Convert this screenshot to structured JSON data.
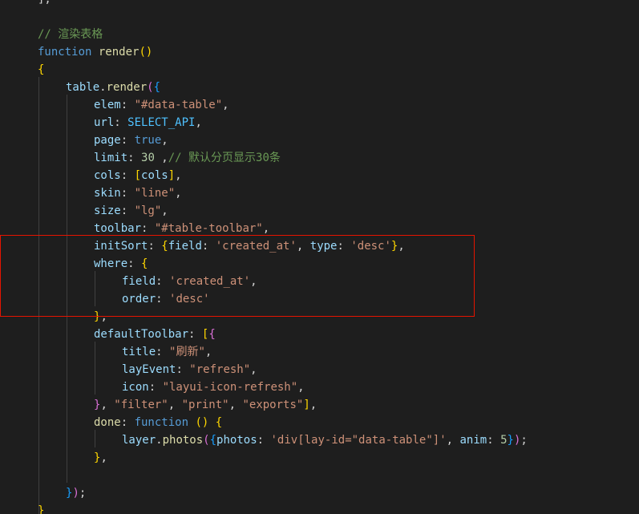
{
  "editor": {
    "theme": "dark",
    "colors": {
      "background": "#1e1e1e",
      "keyword": "#569cd6",
      "function": "#dcdcaa",
      "property": "#9cdcfe",
      "constant": "#4fc1ff",
      "string": "#ce9178",
      "number": "#b5cea8",
      "comment": "#6a9955",
      "highlight_border": "#e51400"
    },
    "lines": [
      {
        "indent": 1,
        "tokens": [
          [
            "pun",
            "],"
          ]
        ]
      },
      {
        "indent": 0,
        "tokens": []
      },
      {
        "indent": 1,
        "tokens": [
          [
            "cmt",
            "// "
          ],
          [
            "cmt cjk",
            "渲染表格"
          ]
        ]
      },
      {
        "indent": 1,
        "tokens": [
          [
            "kw",
            "function"
          ],
          [
            "pun",
            " "
          ],
          [
            "fn",
            "render"
          ],
          [
            "br1",
            "()"
          ]
        ]
      },
      {
        "indent": 1,
        "tokens": [
          [
            "br1",
            "{"
          ]
        ]
      },
      {
        "indent": 2,
        "tokens": [
          [
            "var",
            "table"
          ],
          [
            "pun",
            "."
          ],
          [
            "fn",
            "render"
          ],
          [
            "br2",
            "("
          ],
          [
            "br3",
            "{"
          ]
        ]
      },
      {
        "indent": 3,
        "tokens": [
          [
            "var",
            "elem"
          ],
          [
            "pun",
            ": "
          ],
          [
            "str",
            "\"#data-table\""
          ],
          [
            "pun",
            ","
          ]
        ]
      },
      {
        "indent": 3,
        "tokens": [
          [
            "var",
            "url"
          ],
          [
            "pun",
            ": "
          ],
          [
            "const",
            "SELECT_API"
          ],
          [
            "pun",
            ","
          ]
        ]
      },
      {
        "indent": 3,
        "tokens": [
          [
            "var",
            "page"
          ],
          [
            "pun",
            ": "
          ],
          [
            "kw",
            "true"
          ],
          [
            "pun",
            ","
          ]
        ]
      },
      {
        "indent": 3,
        "tokens": [
          [
            "var",
            "limit"
          ],
          [
            "pun",
            ": "
          ],
          [
            "num",
            "30"
          ],
          [
            "pun",
            " ,"
          ],
          [
            "cmt",
            "// "
          ],
          [
            "cmt cjk",
            "默认分页显示"
          ],
          [
            "cmt",
            "30"
          ],
          [
            "cmt cjk",
            "条"
          ]
        ]
      },
      {
        "indent": 3,
        "tokens": [
          [
            "var",
            "cols"
          ],
          [
            "pun",
            ": "
          ],
          [
            "br1",
            "["
          ],
          [
            "var",
            "cols"
          ],
          [
            "br1",
            "]"
          ],
          [
            "pun",
            ","
          ]
        ]
      },
      {
        "indent": 3,
        "tokens": [
          [
            "var",
            "skin"
          ],
          [
            "pun",
            ": "
          ],
          [
            "str",
            "\"line\""
          ],
          [
            "pun",
            ","
          ]
        ]
      },
      {
        "indent": 3,
        "tokens": [
          [
            "var",
            "size"
          ],
          [
            "pun",
            ": "
          ],
          [
            "str",
            "\"lg\""
          ],
          [
            "pun",
            ","
          ]
        ]
      },
      {
        "indent": 3,
        "tokens": [
          [
            "var",
            "toolbar"
          ],
          [
            "pun",
            ": "
          ],
          [
            "str",
            "\"#table-toolbar\""
          ],
          [
            "pun",
            ","
          ]
        ]
      },
      {
        "indent": 3,
        "tokens": [
          [
            "var",
            "initSort"
          ],
          [
            "pun",
            ": "
          ],
          [
            "br1",
            "{"
          ],
          [
            "var",
            "field"
          ],
          [
            "pun",
            ": "
          ],
          [
            "str",
            "'created_at'"
          ],
          [
            "pun",
            ", "
          ],
          [
            "var",
            "type"
          ],
          [
            "pun",
            ": "
          ],
          [
            "str",
            "'desc'"
          ],
          [
            "br1",
            "}"
          ],
          [
            "pun",
            ","
          ]
        ]
      },
      {
        "indent": 3,
        "tokens": [
          [
            "var",
            "where"
          ],
          [
            "pun",
            ": "
          ],
          [
            "br1",
            "{"
          ]
        ]
      },
      {
        "indent": 4,
        "tokens": [
          [
            "var",
            "field"
          ],
          [
            "pun",
            ": "
          ],
          [
            "str",
            "'created_at'"
          ],
          [
            "pun",
            ","
          ]
        ]
      },
      {
        "indent": 4,
        "tokens": [
          [
            "var",
            "order"
          ],
          [
            "pun",
            ": "
          ],
          [
            "str",
            "'desc'"
          ]
        ]
      },
      {
        "indent": 3,
        "tokens": [
          [
            "br1",
            "}"
          ],
          [
            "pun",
            ","
          ]
        ]
      },
      {
        "indent": 3,
        "tokens": [
          [
            "var",
            "defaultToolbar"
          ],
          [
            "pun",
            ": "
          ],
          [
            "br1",
            "["
          ],
          [
            "br2",
            "{"
          ]
        ]
      },
      {
        "indent": 4,
        "tokens": [
          [
            "var",
            "title"
          ],
          [
            "pun",
            ": "
          ],
          [
            "str",
            "\""
          ],
          [
            "str cjk",
            "刷新"
          ],
          [
            "str",
            "\""
          ],
          [
            "pun",
            ","
          ]
        ]
      },
      {
        "indent": 4,
        "tokens": [
          [
            "var",
            "layEvent"
          ],
          [
            "pun",
            ": "
          ],
          [
            "str",
            "\"refresh\""
          ],
          [
            "pun",
            ","
          ]
        ]
      },
      {
        "indent": 4,
        "tokens": [
          [
            "var",
            "icon"
          ],
          [
            "pun",
            ": "
          ],
          [
            "str",
            "\"layui-icon-refresh\""
          ],
          [
            "pun",
            ","
          ]
        ]
      },
      {
        "indent": 3,
        "tokens": [
          [
            "br2",
            "}"
          ],
          [
            "pun",
            ", "
          ],
          [
            "str",
            "\"filter\""
          ],
          [
            "pun",
            ", "
          ],
          [
            "str",
            "\"print\""
          ],
          [
            "pun",
            ", "
          ],
          [
            "str",
            "\"exports\""
          ],
          [
            "br1",
            "]"
          ],
          [
            "pun",
            ","
          ]
        ]
      },
      {
        "indent": 3,
        "tokens": [
          [
            "fn",
            "done"
          ],
          [
            "pun",
            ": "
          ],
          [
            "kw",
            "function"
          ],
          [
            "pun",
            " "
          ],
          [
            "br1",
            "()"
          ],
          [
            "pun",
            " "
          ],
          [
            "br1",
            "{"
          ]
        ]
      },
      {
        "indent": 4,
        "tokens": [
          [
            "var",
            "layer"
          ],
          [
            "pun",
            "."
          ],
          [
            "fn",
            "photos"
          ],
          [
            "br2",
            "("
          ],
          [
            "br3",
            "{"
          ],
          [
            "var",
            "photos"
          ],
          [
            "pun",
            ": "
          ],
          [
            "str",
            "'div[lay-id=\"data-table\"]'"
          ],
          [
            "pun",
            ", "
          ],
          [
            "var",
            "anim"
          ],
          [
            "pun",
            ": "
          ],
          [
            "num",
            "5"
          ],
          [
            "br3",
            "}"
          ],
          [
            "br2",
            ")"
          ],
          [
            "pun",
            ";"
          ]
        ]
      },
      {
        "indent": 3,
        "tokens": [
          [
            "br1",
            "}"
          ],
          [
            "pun",
            ","
          ]
        ]
      },
      {
        "indent": 0,
        "tokens": []
      },
      {
        "indent": 2,
        "tokens": [
          [
            "br3",
            "}"
          ],
          [
            "br2",
            ")"
          ],
          [
            "pun",
            ";"
          ]
        ]
      },
      {
        "indent": 1,
        "tokens": [
          [
            "br1",
            "}"
          ]
        ]
      }
    ]
  }
}
